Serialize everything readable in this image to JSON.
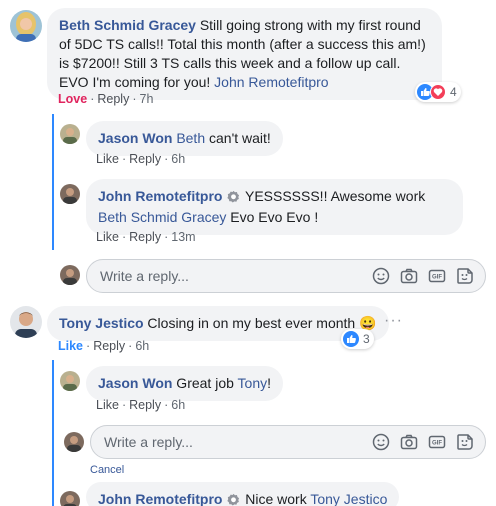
{
  "comments": {
    "c1": {
      "author": "Beth Schmid Gracey",
      "text": " Still going strong with my first round of 5DC TS calls!! Total this month (after a success this am!) is $7200!! Still 3 TS calls this week and a follow up call. EVO I'm coming for you! ",
      "tag": "John Remotefitpro",
      "reaction_label": "Love",
      "reply_label": "Reply",
      "time": "7h",
      "reaction_count": "4"
    },
    "r1": {
      "author": "Jason Won",
      "tag": "Beth",
      "text": " can't wait!",
      "like_label": "Like",
      "reply_label": "Reply",
      "time": "6h"
    },
    "r2": {
      "author": "John Remotefitpro",
      "text_pre": " YESSSSSS!! Awesome work ",
      "tag": "Beth Schmid Gracey",
      "text_post": " Evo Evo Evo !",
      "like_label": "Like",
      "reply_label": "Reply",
      "time": "13m"
    },
    "c2": {
      "author": "Tony Jestico",
      "text": " Closing in on my best ever month ",
      "emoji": "😀",
      "like_label": "Like",
      "reply_label": "Reply",
      "time": "6h",
      "reaction_count": "3"
    },
    "r3": {
      "author": "Jason Won",
      "text": " Great job ",
      "tag": "Tony",
      "text_post": "!",
      "like_label": "Like",
      "reply_label": "Reply",
      "time": "6h"
    },
    "r4": {
      "author": "John Remotefitpro",
      "text": " Nice work ",
      "tag": "Tony Jestico"
    }
  },
  "reply_box": {
    "placeholder": "Write a reply...",
    "cancel_label": "Cancel"
  },
  "colors": {
    "link": "#385898",
    "accent": "#2d88ff",
    "love": "#e0245e",
    "bubble": "#f2f3f5"
  },
  "icons": [
    "smiley-icon",
    "camera-icon",
    "gif-icon",
    "sticker-icon",
    "like-icon",
    "heart-icon",
    "verified-badge-icon",
    "more-options-icon"
  ]
}
